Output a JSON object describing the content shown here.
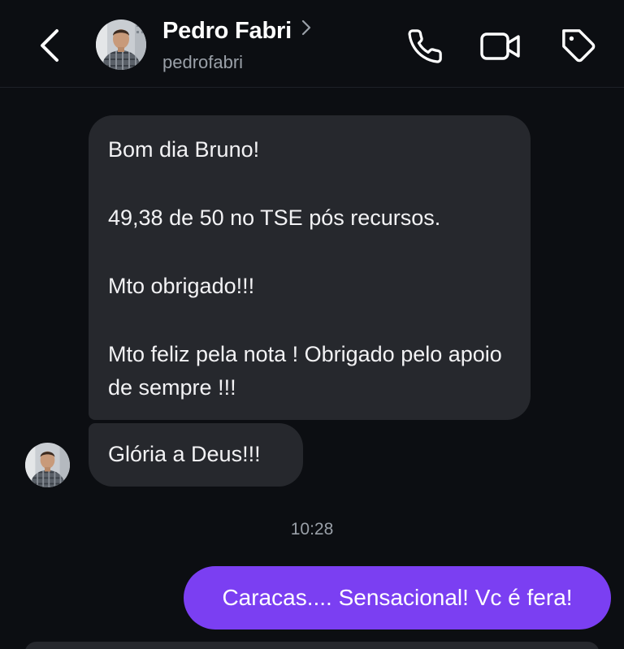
{
  "header": {
    "contact_name": "Pedro Fabri",
    "username": "pedrofabri",
    "icons": {
      "back": "chevron-left-icon",
      "details": "chevron-right-icon",
      "call": "phone-icon",
      "video": "video-camera-icon",
      "tag": "tag-icon"
    }
  },
  "messages": {
    "incoming": [
      {
        "lines": [
          "Bom dia Bruno!",
          "49,38 de 50 no TSE pós recursos.",
          "Mto obrigado!!!",
          "Mto feliz pela nota ! Obrigado pelo apoio de sempre !!!"
        ]
      },
      {
        "text": "Glória a Deus!!!"
      }
    ],
    "timestamp": "10:28",
    "outgoing": [
      {
        "text": "Caracas.... Sensacional! Vc é fera!"
      }
    ]
  },
  "colors": {
    "background": "#0c0e12",
    "incoming_bubble": "#26282d",
    "outgoing_bubble": "#7b3ff2",
    "secondary_text": "#9aa0a8"
  }
}
